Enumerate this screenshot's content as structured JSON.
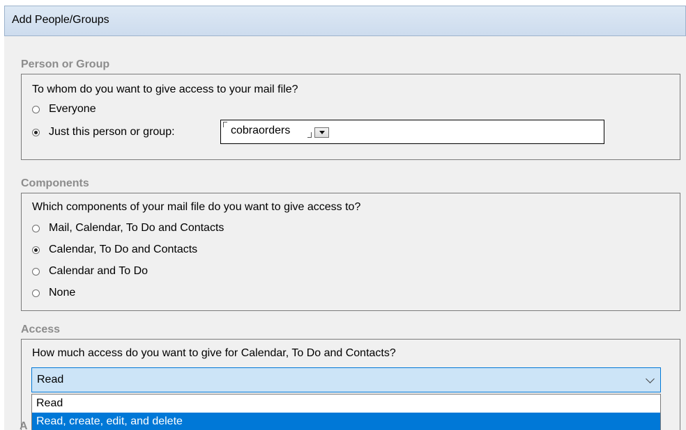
{
  "window": {
    "title": "Add People/Groups"
  },
  "person_or_group": {
    "section_title": "Person or Group",
    "question": "To whom do you want to give access to your mail file?",
    "options": [
      {
        "label": "Everyone",
        "selected": false
      },
      {
        "label": "Just this person or group:",
        "selected": true
      }
    ],
    "person_value": "cobraorders"
  },
  "components": {
    "section_title": "Components",
    "question": "Which components of your mail file do you want to give access to?",
    "options": [
      {
        "label": "Mail, Calendar, To Do and Contacts",
        "selected": false
      },
      {
        "label": "Calendar, To Do and Contacts",
        "selected": true
      },
      {
        "label": "Calendar and To Do",
        "selected": false
      },
      {
        "label": "None",
        "selected": false
      }
    ]
  },
  "access": {
    "section_title": "Access",
    "question": "How much access do you want to give for Calendar, To Do and Contacts?",
    "selected_value": "Read",
    "dropdown_options": [
      {
        "label": "Read",
        "highlighted": false
      },
      {
        "label": "Read, create, edit, and delete",
        "highlighted": true
      }
    ]
  },
  "next_section_peek": "A",
  "colors": {
    "titlebar": "#cddcee",
    "section_title": "#8c8c8c",
    "select_bg": "#cce4f7",
    "highlight": "#0078d7"
  }
}
